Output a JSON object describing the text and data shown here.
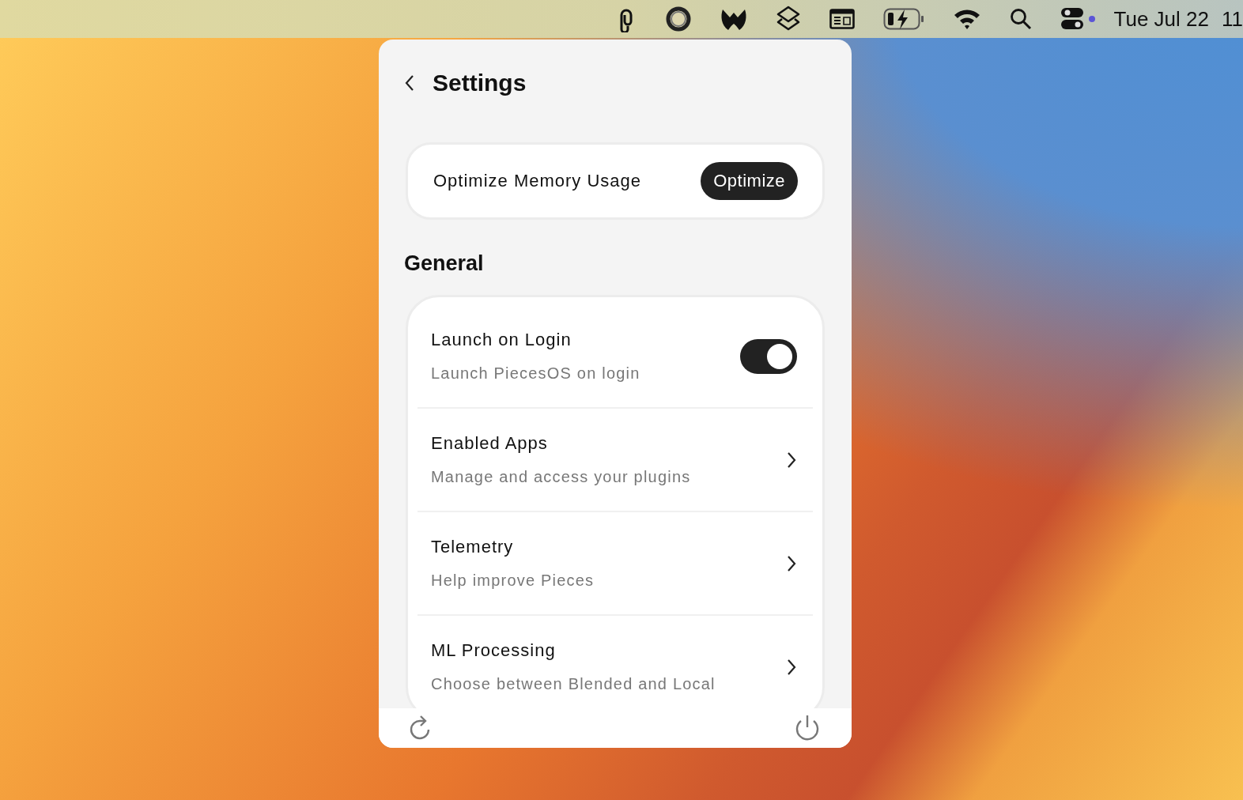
{
  "menu_bar": {
    "date": "Tue Jul 22",
    "time": "11"
  },
  "window": {
    "title": "Settings"
  },
  "memory_card": {
    "label": "Optimize Memory Usage",
    "button": "Optimize"
  },
  "section": {
    "title": "General"
  },
  "settings": [
    {
      "kind": "toggle",
      "title": "Launch on Login",
      "subtitle": "Launch PiecesOS on login",
      "on": true
    },
    {
      "kind": "link",
      "title": "Enabled Apps",
      "subtitle": "Manage and access your plugins"
    },
    {
      "kind": "link",
      "title": "Telemetry",
      "subtitle": "Help improve Pieces"
    },
    {
      "kind": "link",
      "title": "ML Processing",
      "subtitle": "Choose between Blended and Local"
    }
  ]
}
